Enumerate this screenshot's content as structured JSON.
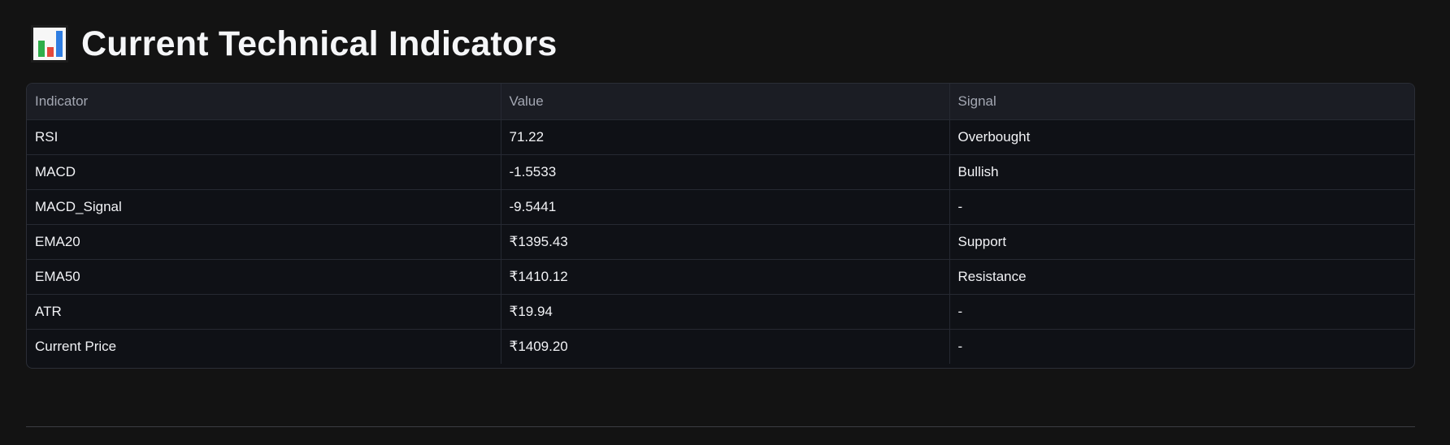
{
  "header": {
    "title": "Current Technical Indicators",
    "icon": "bar-chart-icon"
  },
  "table": {
    "columns": [
      "Indicator",
      "Value",
      "Signal"
    ],
    "rows": [
      {
        "indicator": "RSI",
        "value": "71.22",
        "signal": "Overbought"
      },
      {
        "indicator": "MACD",
        "value": "-1.5533",
        "signal": "Bullish"
      },
      {
        "indicator": "MACD_Signal",
        "value": "-9.5441",
        "signal": "-"
      },
      {
        "indicator": "EMA20",
        "value": "₹1395.43",
        "signal": "Support"
      },
      {
        "indicator": "EMA50",
        "value": "₹1410.12",
        "signal": "Resistance"
      },
      {
        "indicator": "ATR",
        "value": "₹19.94",
        "signal": "-"
      },
      {
        "indicator": "Current Price",
        "value": "₹1409.20",
        "signal": "-"
      }
    ]
  },
  "colors": {
    "background": "#131313",
    "table_background": "#0f1116",
    "header_background": "#1b1d24",
    "border": "#262932"
  }
}
